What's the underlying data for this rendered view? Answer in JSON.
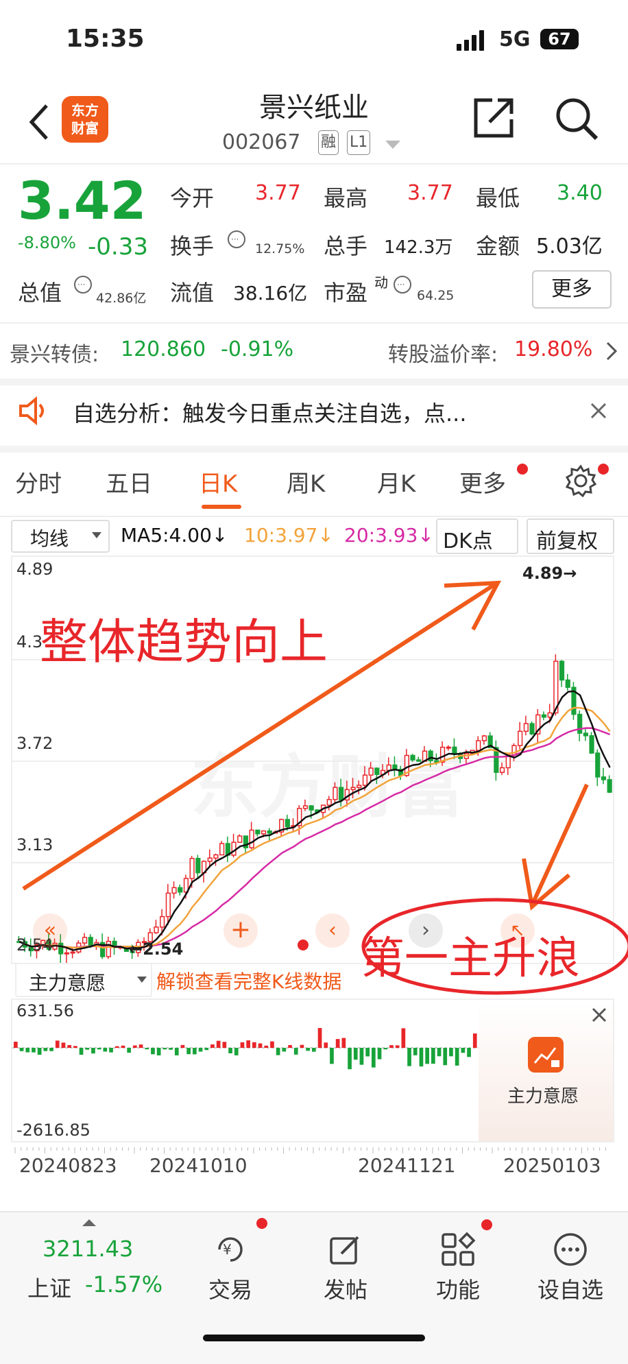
{
  "status_bar": {
    "time": "15:35",
    "network": "5G",
    "battery": "67"
  },
  "header": {
    "logo_line1": "东方",
    "logo_line2": "财富",
    "name": "景兴纸业",
    "code": "002067",
    "tag1": "融",
    "tag2": "L1"
  },
  "quote": {
    "price": "3.42",
    "change_pct": "-8.80%",
    "change": "-0.33",
    "open_label": "今开",
    "open": "3.77",
    "high_label": "最高",
    "high": "3.77",
    "low_label": "最低",
    "low": "3.40",
    "turnover_label": "换手",
    "turnover": "12.75%",
    "volume_label": "总手",
    "volume": "142.3万",
    "amount_label": "金额",
    "amount": "5.03亿",
    "mktcap_label": "总值",
    "mktcap": "42.86亿",
    "float_label": "流值",
    "float": "38.16亿",
    "pe_label": "市盈",
    "pe_sup": "动",
    "pe": "64.25",
    "more": "更多"
  },
  "bond": {
    "label": "景兴转债:",
    "price": "120.860",
    "change": "-0.91%",
    "premium_label": "转股溢价率:",
    "premium": "19.80%"
  },
  "notice": {
    "text": "自选分析：触发今日重点关注自选，点..."
  },
  "tabs": [
    "分时",
    "五日",
    "日K",
    "周K",
    "月K",
    "更多"
  ],
  "active_tab": "日K",
  "chart_toolbar": {
    "ma_select": "均线",
    "ma5": "MA5:4.00↓",
    "ma10": "10:3.97↓",
    "ma20": "20:3.93↓",
    "dk": "DK点",
    "adjust": "前复权"
  },
  "chart": {
    "y_labels": [
      "4.89",
      "4.3",
      "3.72",
      "3.13",
      "2.54"
    ],
    "max_marker": "4.89→",
    "min_marker": "←2.54",
    "annotation_top": "整体趋势向上",
    "annotation_bottom": "第一主升浪",
    "watermark": "东方财富"
  },
  "indicator": {
    "select": "主力意愿",
    "unlock": "解锁查看完整K线数据",
    "top": "631.56",
    "bottom": "-2616.85",
    "card_label": "主力意愿"
  },
  "x_labels": [
    "20240823",
    "20241010",
    "20241121",
    "20250103"
  ],
  "bottom_nav": {
    "index_value": "3211.43",
    "index_name": "上证",
    "index_change": "-1.57%",
    "trade": "交易",
    "post": "发帖",
    "func": "功能",
    "watch": "设自选"
  },
  "colors": {
    "up": "#e8262a",
    "down": "#18a33a",
    "accent": "#f05a1a",
    "ma5": "#111111",
    "ma10": "#f2a33a",
    "ma20": "#d62aa5"
  }
}
